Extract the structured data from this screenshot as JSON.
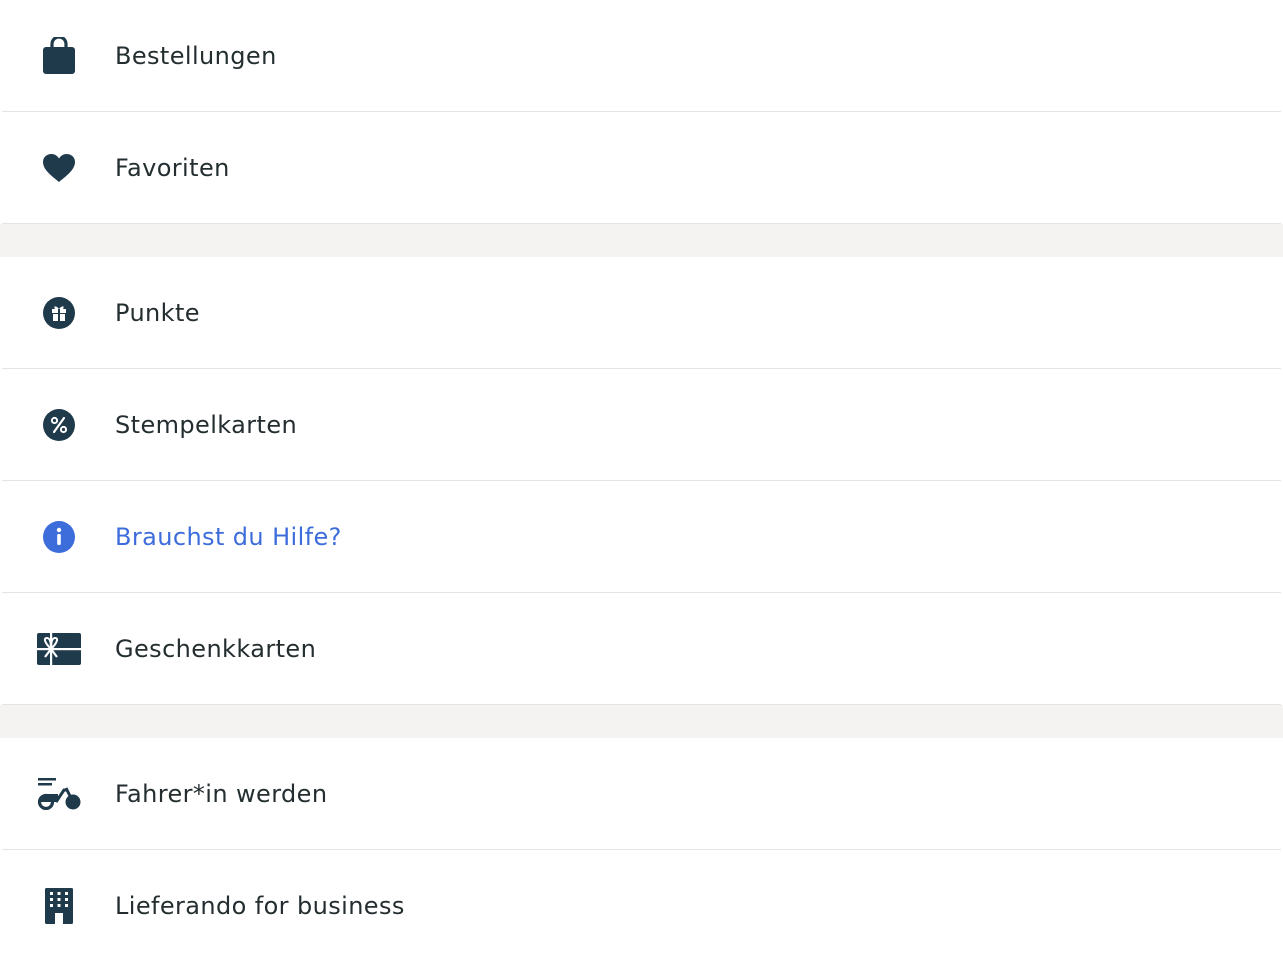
{
  "colors": {
    "icon": "#1f3a4a",
    "text": "#242e30",
    "link": "#3d6cdb",
    "divider": "#e6e4df",
    "section_gap": "#f5f3f1"
  },
  "menu": {
    "group1": [
      {
        "label": "Bestellungen",
        "icon": "shopping-bag-icon"
      },
      {
        "label": "Favoriten",
        "icon": "heart-icon"
      }
    ],
    "group2": [
      {
        "label": "Punkte",
        "icon": "gift-icon"
      },
      {
        "label": "Stempelkarten",
        "icon": "percent-icon"
      },
      {
        "label": "Brauchst du Hilfe?",
        "icon": "info-icon"
      },
      {
        "label": "Geschenkkarten",
        "icon": "gift-card-icon"
      }
    ],
    "group3": [
      {
        "label": "Fahrer*in werden",
        "icon": "scooter-icon"
      },
      {
        "label": "Lieferando for business",
        "icon": "building-icon"
      }
    ]
  }
}
